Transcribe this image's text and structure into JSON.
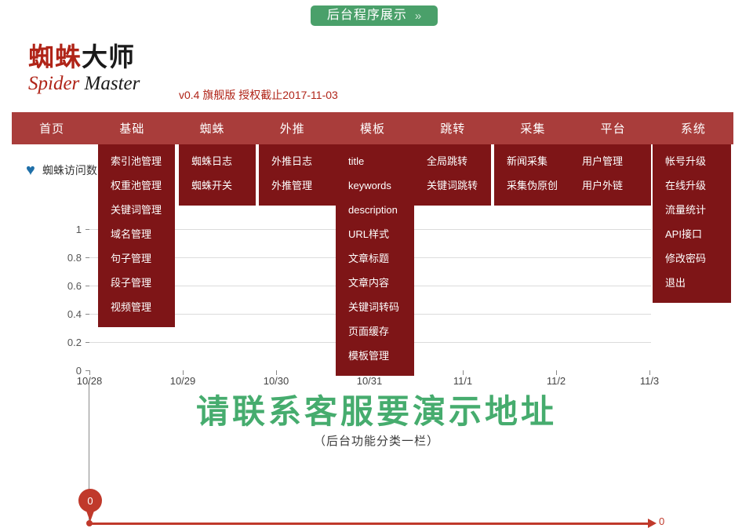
{
  "top_button": {
    "label": "后台程序展示",
    "chevron": "»",
    "color": "#4aa06a"
  },
  "logo": {
    "cn_red": "蜘蛛",
    "cn_black": "大师",
    "en_red": "Spider",
    "en_black": "Master",
    "version_line": "v0.4  旗舰版  授权截止2017-11-03",
    "red": "#b02418"
  },
  "nav": {
    "bar_color": "#a93d3b",
    "dropdown_color": "#7e1517",
    "items": [
      {
        "label": "首页",
        "children": []
      },
      {
        "label": "基础",
        "children": [
          "索引池管理",
          "权重池管理",
          "关键词管理",
          "域名管理",
          "句子管理",
          "段子管理",
          "视频管理"
        ]
      },
      {
        "label": "蜘蛛",
        "children": [
          "蜘蛛日志",
          "蜘蛛开关"
        ]
      },
      {
        "label": "外推",
        "children": [
          "外推日志",
          "外推管理"
        ]
      },
      {
        "label": "模板",
        "children": [
          "title",
          "keywords",
          "description",
          "URL样式",
          "文章标题",
          "文章内容",
          "关键词转码",
          "页面缓存",
          "模板管理"
        ]
      },
      {
        "label": "跳转",
        "children": [
          "全局跳转",
          "关键词跳转"
        ]
      },
      {
        "label": "采集",
        "children": [
          "新闻采集",
          "采集伪原创"
        ]
      },
      {
        "label": "平台",
        "children": [
          "用户管理",
          "用户外链"
        ]
      },
      {
        "label": "系统",
        "children": [
          "帐号升级",
          "在线升级",
          "流量统计",
          "API接口",
          "修改密码",
          "退出"
        ]
      }
    ]
  },
  "chart_data": {
    "type": "line",
    "title": "",
    "legend": [
      "蜘蛛访问数"
    ],
    "legend_position": "top-left",
    "legend_marker": "heart",
    "legend_marker_color": "#1f6fa8",
    "x": [
      "10/28",
      "10/29",
      "10/30",
      "10/31",
      "11/1",
      "11/2",
      "11/3"
    ],
    "series": [
      {
        "name": "蜘蛛访问数",
        "values": [
          0,
          0,
          0,
          0,
          0,
          0,
          0
        ]
      }
    ],
    "xlabel": "",
    "ylabel": "",
    "ylim": [
      0,
      1
    ],
    "yticks": [
      "0",
      "0.2",
      "0.4",
      "0.6",
      "0.8",
      "1"
    ],
    "grid": true,
    "annotations": [
      {
        "text": "0",
        "at": "10/28",
        "style": "pin-marker",
        "color": "#c0392b"
      },
      {
        "text": "0",
        "at": "11/3",
        "style": "end-label",
        "color": "#c0392b"
      }
    ]
  },
  "footer": {
    "main": "请联系客服要演示地址",
    "sub": "（后台功能分类一栏）",
    "main_color": "#46ac6e"
  }
}
